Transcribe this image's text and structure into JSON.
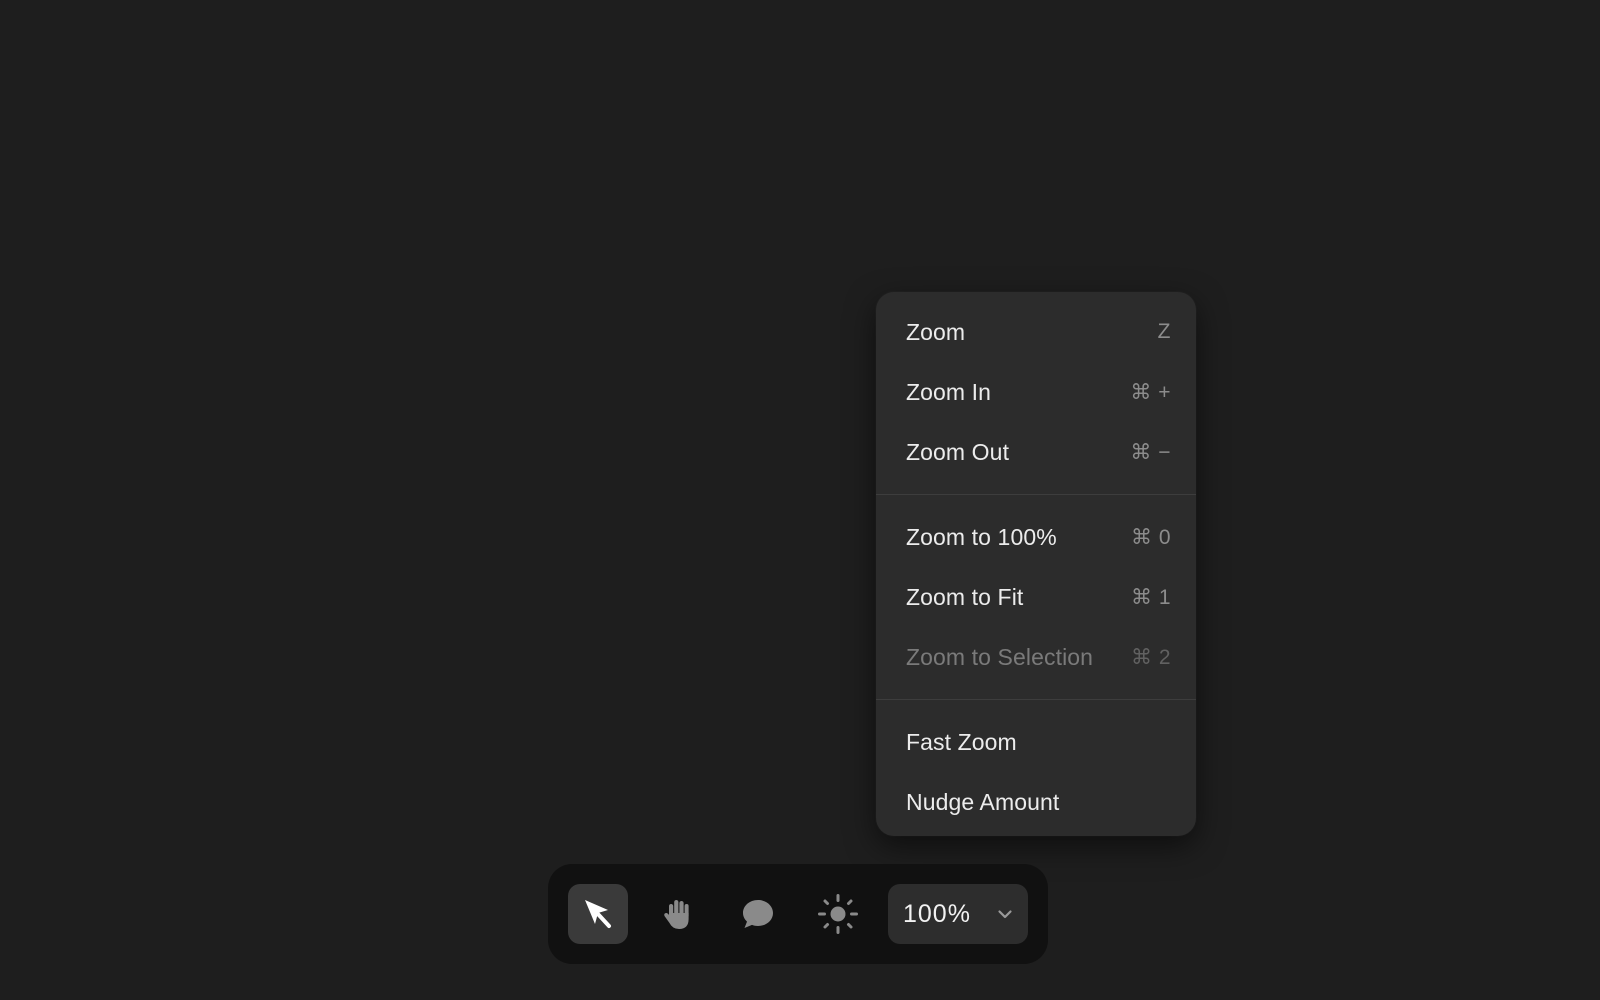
{
  "menu": {
    "groups": [
      {
        "items": [
          {
            "label": "Zoom",
            "shortcut": "Z"
          },
          {
            "label": "Zoom In",
            "shortcut": "⌘ +"
          },
          {
            "label": "Zoom Out",
            "shortcut": "⌘ −"
          }
        ]
      },
      {
        "items": [
          {
            "label": "Zoom to 100%",
            "shortcut": "⌘ 0"
          },
          {
            "label": "Zoom to Fit",
            "shortcut": "⌘ 1"
          },
          {
            "label": "Zoom to Selection",
            "shortcut": "⌘ 2",
            "disabled": true
          }
        ]
      },
      {
        "items": [
          {
            "label": "Fast Zoom",
            "shortcut": ""
          },
          {
            "label": "Nudge Amount",
            "shortcut": ""
          }
        ]
      }
    ]
  },
  "toolbar": {
    "tools": [
      {
        "icon": "cursor-arrow-icon",
        "active": true
      },
      {
        "icon": "hand-icon",
        "active": false
      },
      {
        "icon": "comment-bubble-icon",
        "active": false
      },
      {
        "icon": "sun-icon",
        "active": false
      }
    ],
    "zoom_value": "100%",
    "zoom_dropdown_icon": "chevron-down-icon"
  },
  "colors": {
    "background": "#1e1e1e",
    "menu_background": "#2c2c2c",
    "toolbar_background": "#111111",
    "active_tool": "#3a3a3a",
    "text_primary": "#ececec",
    "text_muted": "#8c8c8c",
    "text_disabled": "#7a7a7a"
  }
}
